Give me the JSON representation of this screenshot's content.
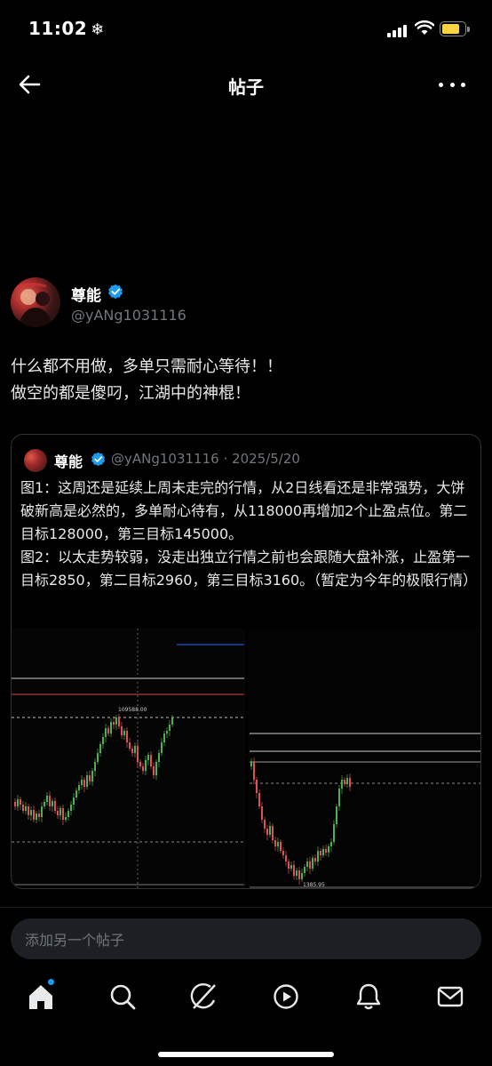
{
  "status": {
    "time": "11:02",
    "weather_icon": "snowflake-icon",
    "battery_color": "#f8d440"
  },
  "header": {
    "title": "帖子",
    "back_icon": "arrow-left-icon",
    "more_icon": "more-icon"
  },
  "post": {
    "author": {
      "name": "尊能",
      "handle": "@yANg1031116",
      "verified": true
    },
    "text_lines": [
      "什么都不用做，多单只需耐心等待！！",
      "做空的都是傻叼，江湖中的神棍！"
    ]
  },
  "quote": {
    "author": {
      "name": "尊能",
      "handle": "@yANg1031116",
      "sep": "·",
      "date": "2025/5/20"
    },
    "text": "图1：这周还是延续上周未走完的行情，从2日线看还是非常强势，大饼破新高是必然的，多单耐心待有，从118000再增加2个止盈点位。第二目标128000，第三目标145000。\n图2：以太走势较弱，没走出独立行情之前也会跟随大盘补涨，止盈第一目标2850，第二目标2960，第三目标3160。（暂定为今年的极限行情）",
    "chart1_label": "109588.00",
    "chart2_label": "1385.95"
  },
  "reply": {
    "placeholder": "添加另一个帖子"
  },
  "tabs": [
    "home-icon",
    "search-icon",
    "grok-icon",
    "video-icon",
    "notifications-icon",
    "messages-icon"
  ],
  "colors": {
    "accent": "#1d9bf0",
    "candle_up": "#4caf50",
    "candle_down": "#e05252"
  }
}
